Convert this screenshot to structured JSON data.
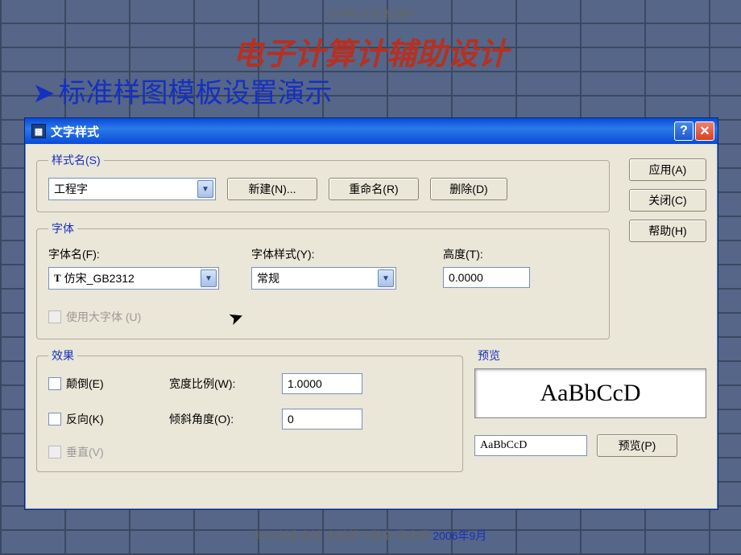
{
  "slide": {
    "header": "文字标注设置课件",
    "title": "电子计算计辅助设计",
    "subtitle_bullet": "➤",
    "subtitle": "标准样图模板设置演示",
    "footer_text": "知识创造卓越   卓越基于勤奋   杨金辉",
    "footer_date": "2006年9月"
  },
  "dialog": {
    "titlebar": {
      "title": "文字样式",
      "help_glyph": "?",
      "close_glyph": "✕"
    },
    "side_buttons": {
      "apply": "应用(A)",
      "close": "关闭(C)",
      "help": "帮助(H)"
    },
    "style_section": {
      "legend": "样式名(S)",
      "style_value": "工程字",
      "new_btn": "新建(N)...",
      "rename_btn": "重命名(R)",
      "delete_btn": "删除(D)"
    },
    "font_section": {
      "legend": "字体",
      "fontname_label": "字体名(F):",
      "fontname_value": "仿宋_GB2312",
      "fontstyle_label": "字体样式(Y):",
      "fontstyle_value": "常规",
      "height_label": "高度(T):",
      "height_value": "0.0000",
      "bigfont_label": "使用大字体 (U)"
    },
    "effects_section": {
      "legend": "效果",
      "upside_down": "颠倒(E)",
      "backwards": "反向(K)",
      "vertical": "垂直(V)",
      "width_label": "宽度比例(W):",
      "width_value": "1.0000",
      "oblique_label": "倾斜角度(O):",
      "oblique_value": "0"
    },
    "preview_section": {
      "label": "预览",
      "sample": "AaBbCcD",
      "input_value": "AaBbCcD",
      "preview_btn": "预览(P)"
    }
  }
}
